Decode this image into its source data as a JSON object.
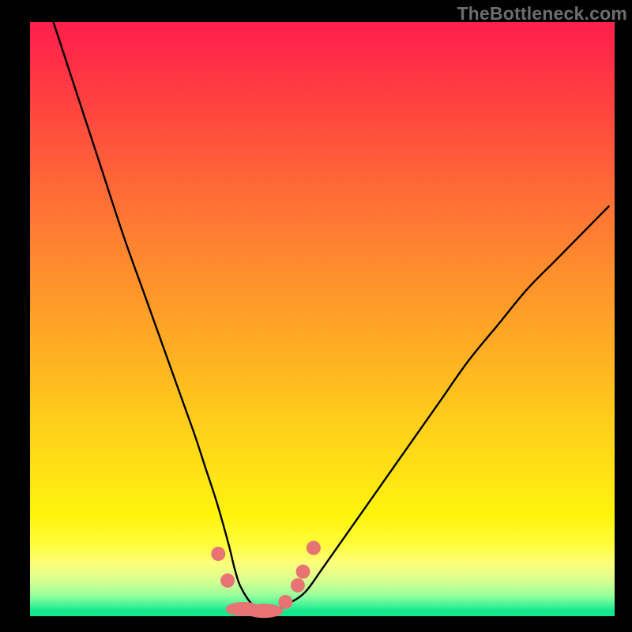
{
  "watermark": "TheBottleneck.com",
  "chart_data": {
    "type": "line",
    "title": "",
    "xlabel": "",
    "ylabel": "",
    "xlim": [
      0,
      100
    ],
    "ylim": [
      0,
      100
    ],
    "gradient_metric_note": "background encodes bottleneck severity: top=red (100% bottleneck), bottom=green (0% bottleneck)",
    "series": [
      {
        "name": "bottleneck-curve",
        "stroke": "#000000",
        "x": [
          4,
          8,
          12,
          16,
          20,
          24,
          28,
          30,
          32,
          34,
          35,
          36,
          38,
          40,
          42,
          44,
          47,
          50,
          55,
          60,
          65,
          70,
          75,
          80,
          85,
          90,
          95,
          99
        ],
        "values": [
          100,
          88,
          76,
          64,
          53,
          42,
          31,
          25,
          19,
          12,
          8,
          5,
          2,
          1,
          1,
          2,
          4,
          8,
          15,
          22,
          29,
          36,
          43,
          49,
          55,
          60,
          65,
          69
        ]
      }
    ],
    "markers": {
      "name": "highlight-dots",
      "color": "#e87373",
      "radius_px": 9,
      "elongated": [
        {
          "x": 36.5,
          "y": 1.2,
          "w": 4.5,
          "h": 1.2
        },
        {
          "x": 40.0,
          "y": 0.9,
          "w": 5.0,
          "h": 1.2
        }
      ],
      "points": [
        {
          "x": 32.2,
          "y": 10.5
        },
        {
          "x": 33.8,
          "y": 6.0
        },
        {
          "x": 43.7,
          "y": 2.4
        },
        {
          "x": 45.8,
          "y": 5.2
        },
        {
          "x": 46.7,
          "y": 7.5
        },
        {
          "x": 48.5,
          "y": 11.5
        }
      ]
    }
  }
}
